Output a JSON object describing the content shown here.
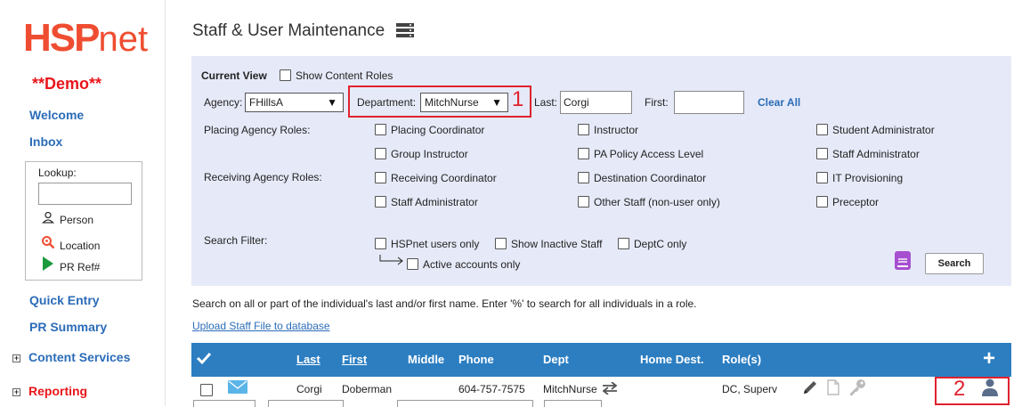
{
  "sidebar": {
    "logo_main": "HSP",
    "logo_suffix": "net",
    "demo_label": "**Demo**",
    "welcome": "Welcome",
    "inbox": "Inbox",
    "lookup": {
      "label": "Lookup:",
      "value": "",
      "items": [
        {
          "label": "Person",
          "icon": "person-icon"
        },
        {
          "label": "Location",
          "icon": "location-search-icon"
        },
        {
          "label": "PR Ref#",
          "icon": "play-icon"
        }
      ]
    },
    "quick_entry": "Quick Entry",
    "pr_summary": "PR Summary",
    "content_services": "Content Services",
    "reporting": "Reporting",
    "expand_symbol": "+"
  },
  "header": {
    "title": "Staff & User Maintenance"
  },
  "search_panel": {
    "current_view_label": "Current View",
    "show_content_roles": "Show Content Roles",
    "agency_label": "Agency:",
    "agency_value": "FHillsA",
    "department_label": "Department:",
    "department_value": "MitchNurse",
    "last_label": "Last:",
    "last_value": "Corgi",
    "first_label": "First:",
    "first_value": "",
    "clear_all": "Clear All",
    "placing_roles_label": "Placing Agency Roles:",
    "receiving_roles_label": "Receiving Agency Roles:",
    "roles": {
      "placing_coordinator": "Placing Coordinator",
      "instructor": "Instructor",
      "student_administrator": "Student Administrator",
      "group_instructor": "Group Instructor",
      "pa_policy_access_level": "PA Policy Access Level",
      "staff_administrator_1": "Staff Administrator",
      "receiving_coordinator": "Receiving Coordinator",
      "destination_coordinator": "Destination Coordinator",
      "it_provisioning": "IT Provisioning",
      "staff_administrator_2": "Staff Administrator",
      "other_staff": "Other Staff (non-user only)",
      "preceptor": "Preceptor"
    },
    "search_filter_label": "Search Filter:",
    "filters": {
      "hspnet_users_only": "HSPnet users only",
      "show_inactive_staff": "Show Inactive Staff",
      "deptc_only": "DeptC only",
      "active_accounts_only": "Active accounts only"
    },
    "search_button": "Search"
  },
  "annotations": {
    "marker_1": "1",
    "marker_2": "2",
    "color": "#e0222e"
  },
  "hint_text": "Search on all or part of the individual's last and/or first name. Enter '%' to search for all individuals in a role.",
  "upload_link": "Upload Staff File to database",
  "table": {
    "header_color": "#2c7ec1",
    "columns": {
      "last": "Last",
      "first": "First",
      "middle": "Middle",
      "phone": "Phone",
      "dept": "Dept",
      "home_dest": "Home Dest.",
      "roles": "Role(s)",
      "add": "+"
    },
    "rows": [
      {
        "last": "Corgi",
        "first": "Doberman",
        "middle": "",
        "phone": "604-757-7575",
        "dept": "MitchNurse",
        "home_dest": "",
        "roles": "DC, Superv"
      }
    ]
  },
  "colors": {
    "accent_blue": "#2b6cb8",
    "brand_orange": "#ef4d31",
    "demo_red": "#e8161b",
    "panel_bg": "#e6eaf8"
  }
}
